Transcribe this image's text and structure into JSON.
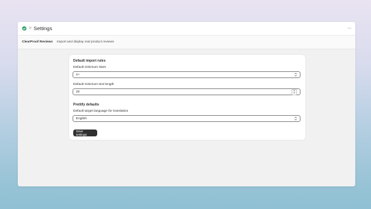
{
  "titlebar": {
    "title": "Settings",
    "separator": ">",
    "more": "···"
  },
  "nav": {
    "app_name": "ClearProof Reviews",
    "description": "Import and display real product reviews"
  },
  "import_rules": {
    "heading": "Default import rules",
    "min_stars_label": "Default minimum stars",
    "min_stars_value": "4+",
    "min_text_label": "Default minimum text length",
    "min_text_value": "20"
  },
  "prettify": {
    "heading": "Prettify defaults",
    "language_label": "Default target language for translation",
    "language_value": "English"
  },
  "actions": {
    "save_label": "Save settings"
  },
  "colors": {
    "primary_button": "#303030",
    "logo_green": "#2e9e6a"
  }
}
